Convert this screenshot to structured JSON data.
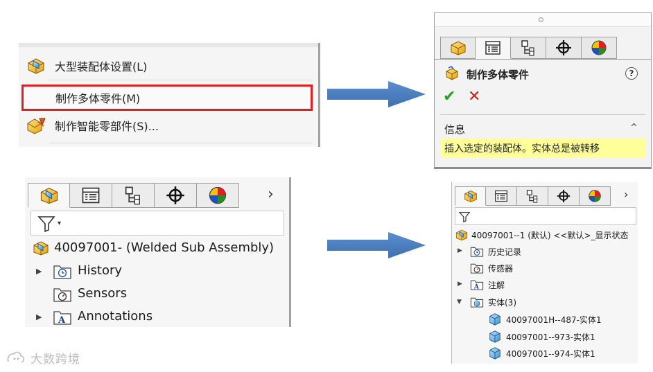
{
  "context_menu": {
    "items": [
      {
        "label": "大型装配体设置(L)",
        "icon": "large-assembly-icon"
      },
      {
        "label": "制作多体零件(M)",
        "icon": "none",
        "highlighted": true,
        "highlight_color": "#e02020"
      },
      {
        "label": "制作智能零部件(S)...",
        "icon": "smart-component-icon"
      }
    ]
  },
  "property_manager": {
    "tabs": [
      "feature-manager-tab-icon",
      "property-manager-tab-icon",
      "configuration-manager-tab-icon",
      "dimxpert-tab-icon",
      "display-manager-tab-icon"
    ],
    "title": "制作多体零件",
    "help_label": "?",
    "ok_label": "✔",
    "cancel_label": "✕",
    "info_section": {
      "heading": "信息",
      "collapse_label": "^",
      "text": "插入选定的装配体。实体总是被转移",
      "highlight_color": "#ffff99"
    }
  },
  "feature_tree_large": {
    "tabs": [
      "feature-manager-tab-icon",
      "property-manager-tab-icon",
      "configuration-manager-tab-icon",
      "dimxpert-tab-icon",
      "display-manager-tab-icon"
    ],
    "more_label": "›",
    "filter_label": "▾",
    "root_label": "40097001- (Welded Sub Assembly)",
    "items": [
      {
        "label": "History",
        "expandable": true,
        "icon": "history-folder-icon"
      },
      {
        "label": "Sensors",
        "expandable": false,
        "icon": "sensors-folder-icon"
      },
      {
        "label": "Annotations",
        "expandable": true,
        "icon": "annotations-folder-icon"
      }
    ]
  },
  "feature_tree_small": {
    "tabs": [
      "feature-manager-tab-icon",
      "property-manager-tab-icon",
      "configuration-manager-tab-icon",
      "dimxpert-tab-icon",
      "display-manager-tab-icon"
    ],
    "more_label": "›",
    "root_label": "40097001--1 (默认) <<默认>_显示状态",
    "items": [
      {
        "label": "历史记录",
        "expandable": true,
        "expanded": false,
        "icon": "history-folder-icon"
      },
      {
        "label": "传感器",
        "expandable": false,
        "icon": "sensors-folder-icon"
      },
      {
        "label": "注解",
        "expandable": true,
        "expanded": false,
        "icon": "annotations-folder-icon"
      },
      {
        "label": "实体(3)",
        "expandable": true,
        "expanded": true,
        "icon": "solid-bodies-folder-icon"
      }
    ],
    "bodies": [
      {
        "label": "40097001H--487-实体1",
        "icon": "solid-body-icon"
      },
      {
        "label": "40097001--973-实体1",
        "icon": "solid-body-icon"
      },
      {
        "label": "40097001--974-实体1",
        "icon": "solid-body-icon"
      }
    ]
  },
  "arrows": {
    "color": "#4a7ebb"
  },
  "watermark": {
    "text": "大数跨境"
  }
}
